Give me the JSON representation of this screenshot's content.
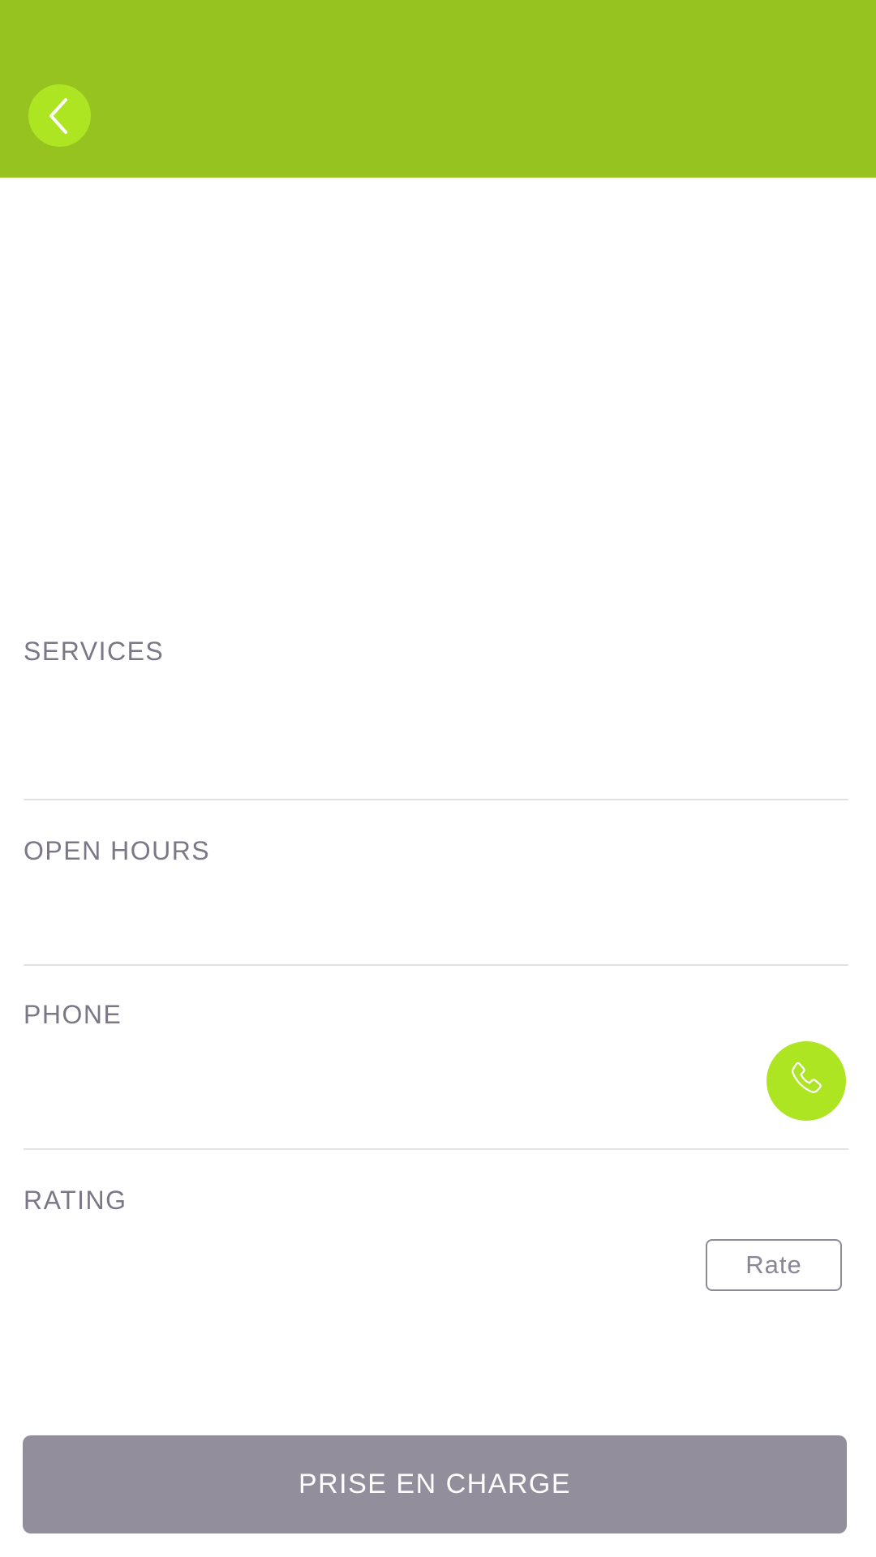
{
  "header": {
    "back_icon": "chevron-left-icon",
    "background_color": "#96c31f",
    "accent_color": "#ade523"
  },
  "sections": {
    "services_label": "SERVICES",
    "open_hours_label": "OPEN HOURS",
    "phone_label": "PHONE",
    "rating_label": "RATING"
  },
  "phone": {
    "call_icon": "phone-icon"
  },
  "rating": {
    "rate_button_label": "Rate"
  },
  "footer": {
    "cta_label": "PRISE EN CHARGE",
    "cta_color": "#938e9c"
  }
}
